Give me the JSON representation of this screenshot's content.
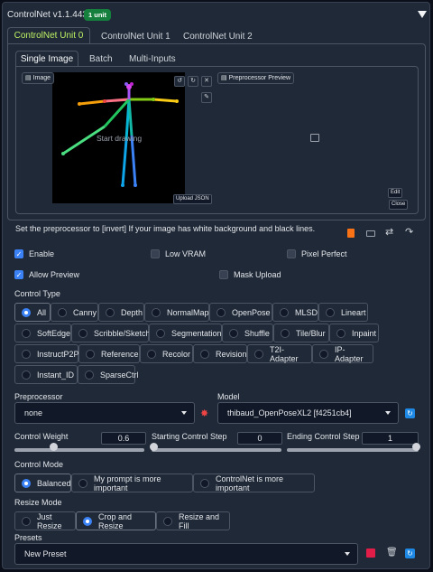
{
  "header": {
    "title": "ControlNet v1.1.443",
    "badge": "1 unit"
  },
  "unit_tabs": [
    "ControlNet Unit 0",
    "ControlNet Unit 1",
    "ControlNet Unit 2"
  ],
  "input_tabs": [
    "Single Image",
    "Batch",
    "Multi-Inputs"
  ],
  "canvas": {
    "image_label": "Image",
    "placeholder": "Start drawing",
    "upload_json": "Upload JSON",
    "preprocessor_preview_label": "Preprocessor Preview",
    "edit_label": "Edit",
    "close_label": "Close"
  },
  "hint": "Set the preprocessor to [invert] If your image has white background and black lines.",
  "options": {
    "enable": "Enable",
    "low_vram": "Low VRAM",
    "pixel_perfect": "Pixel Perfect",
    "allow_preview": "Allow Preview",
    "mask_upload": "Mask Upload",
    "enable_checked": true,
    "allow_preview_checked": true
  },
  "control_type": {
    "label": "Control Type",
    "selected": "All",
    "items": [
      "All",
      "Canny",
      "Depth",
      "NormalMap",
      "OpenPose",
      "MLSD",
      "Lineart",
      "SoftEdge",
      "Scribble/Sketch",
      "Segmentation",
      "Shuffle",
      "Tile/Blur",
      "Inpaint",
      "InstructP2P",
      "Reference",
      "Recolor",
      "Revision",
      "T2I-Adapter",
      "IP-Adapter",
      "Instant_ID",
      "SparseCtrl"
    ]
  },
  "preprocessor": {
    "label": "Preprocessor",
    "value": "none"
  },
  "model": {
    "label": "Model",
    "value": "thibaud_OpenPoseXL2 [f4251cb4]"
  },
  "sliders": {
    "control_weight": {
      "label": "Control Weight",
      "value": "0.6",
      "fraction": 0.3
    },
    "start_step": {
      "label": "Starting Control Step",
      "value": "0",
      "fraction": 0.0
    },
    "end_step": {
      "label": "Ending Control Step",
      "value": "1",
      "fraction": 1.0
    }
  },
  "control_mode": {
    "label": "Control Mode",
    "items": [
      "Balanced",
      "My prompt is more important",
      "ControlNet is more important"
    ],
    "selected": "Balanced"
  },
  "resize_mode": {
    "label": "Resize Mode",
    "items": [
      "Just Resize",
      "Crop and Resize",
      "Resize and Fill"
    ],
    "selected": "Crop and Resize"
  },
  "presets": {
    "label": "Presets",
    "value": "New Preset"
  },
  "colors": {
    "accent": "#3b82f6",
    "badge": "#15803d",
    "icon_blue": "#1e88e5"
  }
}
